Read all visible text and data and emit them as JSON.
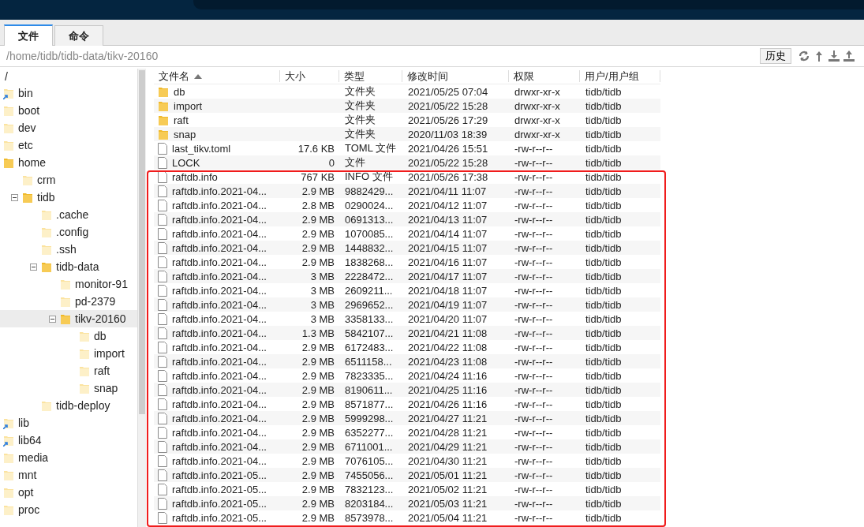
{
  "tabs": [
    {
      "label": "文件",
      "selected": true
    },
    {
      "label": "命令",
      "selected": false
    }
  ],
  "path": {
    "value": "/home/tidb/tidb-data/tikv-20160",
    "history_button": "历史"
  },
  "tree": {
    "root": "/",
    "items": [
      {
        "label": "bin",
        "kind": "link",
        "expanded": false,
        "selected": false
      },
      {
        "label": "boot",
        "kind": "folder",
        "expanded": false,
        "selected": false
      },
      {
        "label": "dev",
        "kind": "folder",
        "expanded": false,
        "selected": false
      },
      {
        "label": "etc",
        "kind": "folder",
        "expanded": false,
        "selected": false
      },
      {
        "label": "home",
        "kind": "folder",
        "expanded": true,
        "selected": false,
        "children": [
          {
            "label": "crm",
            "kind": "folder",
            "expanded": false,
            "selected": false
          },
          {
            "label": "tidb",
            "kind": "folder",
            "expanded": true,
            "selected": false,
            "children": [
              {
                "label": ".cache",
                "kind": "folder",
                "expanded": false,
                "selected": false
              },
              {
                "label": ".config",
                "kind": "folder",
                "expanded": false,
                "selected": false
              },
              {
                "label": ".ssh",
                "kind": "folder",
                "expanded": false,
                "selected": false
              },
              {
                "label": "tidb-data",
                "kind": "folder",
                "expanded": true,
                "selected": false,
                "children": [
                  {
                    "label": "monitor-91",
                    "kind": "folder",
                    "expanded": false,
                    "selected": false
                  },
                  {
                    "label": "pd-2379",
                    "kind": "folder",
                    "expanded": false,
                    "selected": false
                  },
                  {
                    "label": "tikv-20160",
                    "kind": "folder",
                    "expanded": true,
                    "selected": true,
                    "children": [
                      {
                        "label": "db",
                        "kind": "folder",
                        "expanded": false,
                        "selected": false
                      },
                      {
                        "label": "import",
                        "kind": "folder",
                        "expanded": false,
                        "selected": false
                      },
                      {
                        "label": "raft",
                        "kind": "folder",
                        "expanded": false,
                        "selected": false
                      },
                      {
                        "label": "snap",
                        "kind": "folder",
                        "expanded": false,
                        "selected": false
                      }
                    ]
                  }
                ]
              },
              {
                "label": "tidb-deploy",
                "kind": "folder",
                "expanded": false,
                "selected": false
              }
            ]
          }
        ]
      },
      {
        "label": "lib",
        "kind": "link",
        "expanded": false,
        "selected": false
      },
      {
        "label": "lib64",
        "kind": "link",
        "expanded": false,
        "selected": false
      },
      {
        "label": "media",
        "kind": "folder",
        "expanded": false,
        "selected": false
      },
      {
        "label": "mnt",
        "kind": "folder",
        "expanded": false,
        "selected": false
      },
      {
        "label": "opt",
        "kind": "folder",
        "expanded": false,
        "selected": false
      },
      {
        "label": "proc",
        "kind": "folder",
        "expanded": false,
        "selected": false
      }
    ]
  },
  "table": {
    "columns": [
      {
        "label": "文件名",
        "sorted": true
      },
      {
        "label": "大小",
        "sorted": false
      },
      {
        "label": "类型",
        "sorted": false
      },
      {
        "label": "修改时间",
        "sorted": false
      },
      {
        "label": "权限",
        "sorted": false
      },
      {
        "label": "用户/用户组",
        "sorted": false
      }
    ],
    "rows": [
      {
        "kind": "folder",
        "name": "db",
        "size": "",
        "type": "文件夹",
        "modified": "2021/05/25 07:04",
        "permissions": "drwxr-xr-x",
        "owner": "tidb/tidb"
      },
      {
        "kind": "folder",
        "name": "import",
        "size": "",
        "type": "文件夹",
        "modified": "2021/05/22 15:28",
        "permissions": "drwxr-xr-x",
        "owner": "tidb/tidb"
      },
      {
        "kind": "folder",
        "name": "raft",
        "size": "",
        "type": "文件夹",
        "modified": "2021/05/26 17:29",
        "permissions": "drwxr-xr-x",
        "owner": "tidb/tidb"
      },
      {
        "kind": "folder",
        "name": "snap",
        "size": "",
        "type": "文件夹",
        "modified": "2020/11/03 18:39",
        "permissions": "drwxr-xr-x",
        "owner": "tidb/tidb"
      },
      {
        "kind": "file",
        "name": "last_tikv.toml",
        "size": "17.6 KB",
        "type": "TOML 文件",
        "modified": "2021/04/26 15:51",
        "permissions": "-rw-r--r--",
        "owner": "tidb/tidb"
      },
      {
        "kind": "file",
        "name": "LOCK",
        "size": "0",
        "type": "文件",
        "modified": "2021/05/22 15:28",
        "permissions": "-rw-r--r--",
        "owner": "tidb/tidb"
      },
      {
        "kind": "file",
        "name": "raftdb.info",
        "size": "767 KB",
        "type": "INFO 文件",
        "modified": "2021/05/26 17:38",
        "permissions": "-rw-r--r--",
        "owner": "tidb/tidb"
      },
      {
        "kind": "file",
        "name": "raftdb.info.2021-04...",
        "size": "2.9 MB",
        "type": "9882429...",
        "modified": "2021/04/11 11:07",
        "permissions": "-rw-r--r--",
        "owner": "tidb/tidb"
      },
      {
        "kind": "file",
        "name": "raftdb.info.2021-04...",
        "size": "2.8 MB",
        "type": "0290024...",
        "modified": "2021/04/12 11:07",
        "permissions": "-rw-r--r--",
        "owner": "tidb/tidb"
      },
      {
        "kind": "file",
        "name": "raftdb.info.2021-04...",
        "size": "2.9 MB",
        "type": "0691313...",
        "modified": "2021/04/13 11:07",
        "permissions": "-rw-r--r--",
        "owner": "tidb/tidb"
      },
      {
        "kind": "file",
        "name": "raftdb.info.2021-04...",
        "size": "2.9 MB",
        "type": "1070085...",
        "modified": "2021/04/14 11:07",
        "permissions": "-rw-r--r--",
        "owner": "tidb/tidb"
      },
      {
        "kind": "file",
        "name": "raftdb.info.2021-04...",
        "size": "2.9 MB",
        "type": "1448832...",
        "modified": "2021/04/15 11:07",
        "permissions": "-rw-r--r--",
        "owner": "tidb/tidb"
      },
      {
        "kind": "file",
        "name": "raftdb.info.2021-04...",
        "size": "2.9 MB",
        "type": "1838268...",
        "modified": "2021/04/16 11:07",
        "permissions": "-rw-r--r--",
        "owner": "tidb/tidb"
      },
      {
        "kind": "file",
        "name": "raftdb.info.2021-04...",
        "size": "3 MB",
        "type": "2228472...",
        "modified": "2021/04/17 11:07",
        "permissions": "-rw-r--r--",
        "owner": "tidb/tidb"
      },
      {
        "kind": "file",
        "name": "raftdb.info.2021-04...",
        "size": "3 MB",
        "type": "2609211...",
        "modified": "2021/04/18 11:07",
        "permissions": "-rw-r--r--",
        "owner": "tidb/tidb"
      },
      {
        "kind": "file",
        "name": "raftdb.info.2021-04...",
        "size": "3 MB",
        "type": "2969652...",
        "modified": "2021/04/19 11:07",
        "permissions": "-rw-r--r--",
        "owner": "tidb/tidb"
      },
      {
        "kind": "file",
        "name": "raftdb.info.2021-04...",
        "size": "3 MB",
        "type": "3358133...",
        "modified": "2021/04/20 11:07",
        "permissions": "-rw-r--r--",
        "owner": "tidb/tidb"
      },
      {
        "kind": "file",
        "name": "raftdb.info.2021-04...",
        "size": "1.3 MB",
        "type": "5842107...",
        "modified": "2021/04/21 11:08",
        "permissions": "-rw-r--r--",
        "owner": "tidb/tidb"
      },
      {
        "kind": "file",
        "name": "raftdb.info.2021-04...",
        "size": "2.9 MB",
        "type": "6172483...",
        "modified": "2021/04/22 11:08",
        "permissions": "-rw-r--r--",
        "owner": "tidb/tidb"
      },
      {
        "kind": "file",
        "name": "raftdb.info.2021-04...",
        "size": "2.9 MB",
        "type": "6511158...",
        "modified": "2021/04/23 11:08",
        "permissions": "-rw-r--r--",
        "owner": "tidb/tidb"
      },
      {
        "kind": "file",
        "name": "raftdb.info.2021-04...",
        "size": "2.9 MB",
        "type": "7823335...",
        "modified": "2021/04/24 11:16",
        "permissions": "-rw-r--r--",
        "owner": "tidb/tidb"
      },
      {
        "kind": "file",
        "name": "raftdb.info.2021-04...",
        "size": "2.9 MB",
        "type": "8190611...",
        "modified": "2021/04/25 11:16",
        "permissions": "-rw-r--r--",
        "owner": "tidb/tidb"
      },
      {
        "kind": "file",
        "name": "raftdb.info.2021-04...",
        "size": "2.9 MB",
        "type": "8571877...",
        "modified": "2021/04/26 11:16",
        "permissions": "-rw-r--r--",
        "owner": "tidb/tidb"
      },
      {
        "kind": "file",
        "name": "raftdb.info.2021-04...",
        "size": "2.9 MB",
        "type": "5999298...",
        "modified": "2021/04/27 11:21",
        "permissions": "-rw-r--r--",
        "owner": "tidb/tidb"
      },
      {
        "kind": "file",
        "name": "raftdb.info.2021-04...",
        "size": "2.9 MB",
        "type": "6352277...",
        "modified": "2021/04/28 11:21",
        "permissions": "-rw-r--r--",
        "owner": "tidb/tidb"
      },
      {
        "kind": "file",
        "name": "raftdb.info.2021-04...",
        "size": "2.9 MB",
        "type": "6711001...",
        "modified": "2021/04/29 11:21",
        "permissions": "-rw-r--r--",
        "owner": "tidb/tidb"
      },
      {
        "kind": "file",
        "name": "raftdb.info.2021-04...",
        "size": "2.9 MB",
        "type": "7076105...",
        "modified": "2021/04/30 11:21",
        "permissions": "-rw-r--r--",
        "owner": "tidb/tidb"
      },
      {
        "kind": "file",
        "name": "raftdb.info.2021-05...",
        "size": "2.9 MB",
        "type": "7455056...",
        "modified": "2021/05/01 11:21",
        "permissions": "-rw-r--r--",
        "owner": "tidb/tidb"
      },
      {
        "kind": "file",
        "name": "raftdb.info.2021-05...",
        "size": "2.9 MB",
        "type": "7832123...",
        "modified": "2021/05/02 11:21",
        "permissions": "-rw-r--r--",
        "owner": "tidb/tidb"
      },
      {
        "kind": "file",
        "name": "raftdb.info.2021-05...",
        "size": "2.9 MB",
        "type": "8203184...",
        "modified": "2021/05/03 11:21",
        "permissions": "-rw-r--r--",
        "owner": "tidb/tidb"
      },
      {
        "kind": "file",
        "name": "raftdb.info.2021-05...",
        "size": "2.9 MB",
        "type": "8573978...",
        "modified": "2021/05/04 11:21",
        "permissions": "-rw-r--r--",
        "owner": "tidb/tidb"
      }
    ]
  }
}
